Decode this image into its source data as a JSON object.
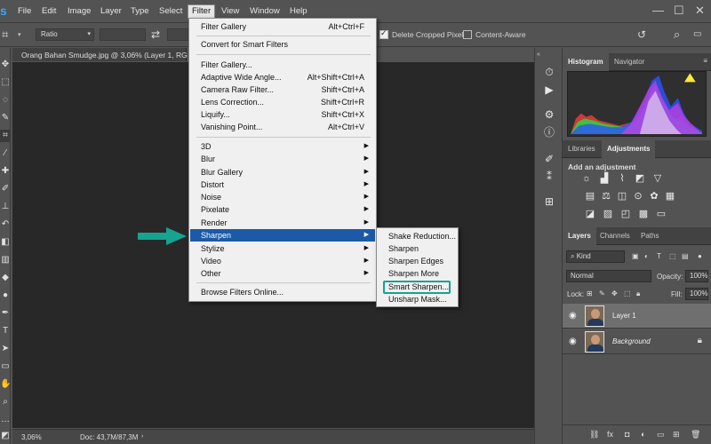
{
  "menubar": {
    "app_logo": "s",
    "items": [
      "File",
      "Edit",
      "Image",
      "Layer",
      "Type",
      "Select",
      "Filter",
      "View",
      "Window",
      "Help"
    ],
    "active": "Filter",
    "window_controls": [
      "—",
      "☐",
      "✕"
    ]
  },
  "options_bar": {
    "ratio_label": "Ratio",
    "delete_cropped_label": "Delete Cropped Pixels",
    "delete_cropped_checked": true,
    "content_aware_label": "Content-Aware",
    "content_aware_checked": false
  },
  "document": {
    "tab_title": "Orang Bahan Smudge.jpg @ 3,06% (Layer 1, RG"
  },
  "status_bar": {
    "zoom": "3,06%",
    "doc_size": "Doc: 43,7M/87,3M"
  },
  "panels": {
    "top_tabs": [
      "Histogram",
      "Navigator"
    ],
    "top_active": "Histogram",
    "mid_tabs": [
      "Libraries",
      "Adjustments"
    ],
    "mid_active": "Adjustments",
    "adjustments_title": "Add an adjustment",
    "layers_tabs": [
      "Layers",
      "Channels",
      "Paths"
    ],
    "layers_active": "Layers",
    "kind_label": "Kind",
    "blend_mode": "Normal",
    "opacity_label": "Opacity:",
    "opacity_value": "100%",
    "lock_label": "Lock:",
    "fill_label": "Fill:",
    "fill_value": "100%",
    "layers": [
      {
        "name": "Layer 1",
        "selected": true,
        "locked": false
      },
      {
        "name": "Background",
        "selected": false,
        "locked": true
      }
    ]
  },
  "filter_menu": {
    "group1": [
      {
        "label": "Filter Gallery",
        "shortcut": "Alt+Ctrl+F"
      },
      {
        "label": "Convert for Smart Filters",
        "shortcut": ""
      }
    ],
    "group2": [
      {
        "label": "Filter Gallery...",
        "shortcut": ""
      },
      {
        "label": "Adaptive Wide Angle...",
        "shortcut": "Alt+Shift+Ctrl+A"
      },
      {
        "label": "Camera Raw Filter...",
        "shortcut": "Shift+Ctrl+A"
      },
      {
        "label": "Lens Correction...",
        "shortcut": "Shift+Ctrl+R"
      },
      {
        "label": "Liquify...",
        "shortcut": "Shift+Ctrl+X"
      },
      {
        "label": "Vanishing Point...",
        "shortcut": "Alt+Ctrl+V"
      }
    ],
    "group3": [
      "3D",
      "Blur",
      "Blur Gallery",
      "Distort",
      "Noise",
      "Pixelate",
      "Render",
      "Sharpen",
      "Stylize",
      "Video",
      "Other"
    ],
    "highlighted": "Sharpen",
    "group4": [
      "Browse Filters Online..."
    ]
  },
  "sharpen_submenu": {
    "items": [
      "Shake Reduction...",
      "Sharpen",
      "Sharpen Edges",
      "Sharpen More",
      "Smart Sharpen...",
      "Unsharp Mask..."
    ],
    "highlighted": "Smart Sharpen..."
  },
  "colors": {
    "accent_highlight": "#1c5aa8",
    "annotation_teal": "#16a38f",
    "ps_blue": "#31a8ff"
  }
}
